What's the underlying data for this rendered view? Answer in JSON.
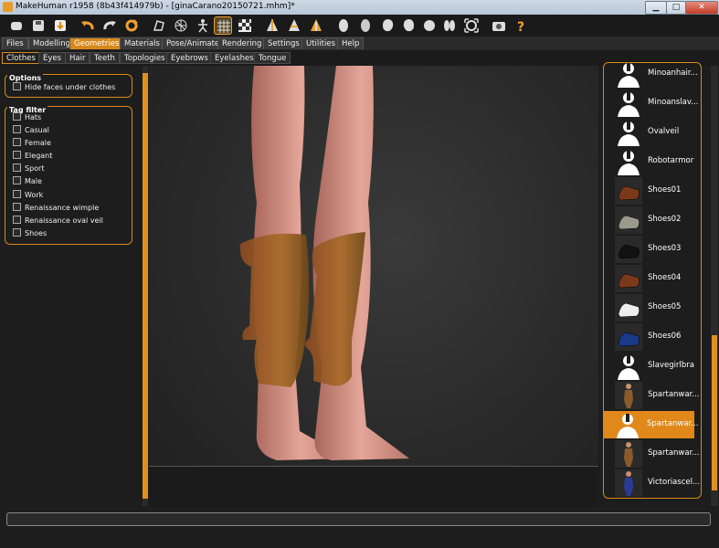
{
  "window": {
    "title": "MakeHuman r1958 (8b43f414979b) - [ginaCarano20150721.mhm]*",
    "buttons": {
      "minimize": "▁",
      "maximize": "□",
      "close": "✕"
    }
  },
  "toolbar": {
    "icons": [
      "new-file",
      "save",
      "export",
      "undo",
      "redo",
      "reset",
      "smooth",
      "wireframe",
      "pose",
      "grid",
      "background",
      "front-view",
      "side-view",
      "back-view",
      "left-head",
      "right-head",
      "top-head",
      "bottom-head",
      "face-left",
      "face-right",
      "reset-camera",
      "screenshot",
      "help"
    ]
  },
  "menu_tabs": [
    "Files",
    "Modelling",
    "Geometries",
    "Materials",
    "Pose/Animate",
    "Rendering",
    "Settings",
    "Utilities",
    "Help"
  ],
  "menu_active": "Geometries",
  "sub_tabs": [
    "Clothes",
    "Eyes",
    "Hair",
    "Teeth",
    "Topologies",
    "Eyebrows",
    "Eyelashes",
    "Tongue"
  ],
  "sub_active": "Clothes",
  "options": {
    "title": "Options",
    "items": [
      {
        "label": "Hide faces under clothes"
      }
    ]
  },
  "tag_filter": {
    "title": "Tag filter",
    "items": [
      {
        "label": "Hats"
      },
      {
        "label": "Casual"
      },
      {
        "label": "Female"
      },
      {
        "label": "Elegant"
      },
      {
        "label": "Sport"
      },
      {
        "label": "Male"
      },
      {
        "label": "Work"
      },
      {
        "label": "Renaissance wimple"
      },
      {
        "label": "Renaissance oval veil"
      },
      {
        "label": "Shoes"
      }
    ]
  },
  "clothes_list": {
    "items": [
      {
        "label": "Minoanhair...",
        "thumb": "none"
      },
      {
        "label": "Minoanslav...",
        "thumb": "none"
      },
      {
        "label": "Ovalveil",
        "thumb": "none"
      },
      {
        "label": "Robotarmor",
        "thumb": "none"
      },
      {
        "label": "Shoes01",
        "thumb": "shoe-brown"
      },
      {
        "label": "Shoes02",
        "thumb": "shoe-gray"
      },
      {
        "label": "Shoes03",
        "thumb": "shoe-black"
      },
      {
        "label": "Shoes04",
        "thumb": "shoe-brown"
      },
      {
        "label": "Shoes05",
        "thumb": "shoe-white"
      },
      {
        "label": "Shoes06",
        "thumb": "shoe-blue"
      },
      {
        "label": "Slavegirlbra",
        "thumb": "none"
      },
      {
        "label": "Spartanwar...",
        "thumb": "figure-brown"
      },
      {
        "label": "Spartanwar...",
        "thumb": "none",
        "selected": true
      },
      {
        "label": "Spartanwar...",
        "thumb": "figure-brown"
      },
      {
        "label": "Victoriascel...",
        "thumb": "figure-blue"
      }
    ]
  },
  "colors": {
    "accent": "#d8891c",
    "panel": "#1d1d1d",
    "selected": "#e0891a"
  }
}
